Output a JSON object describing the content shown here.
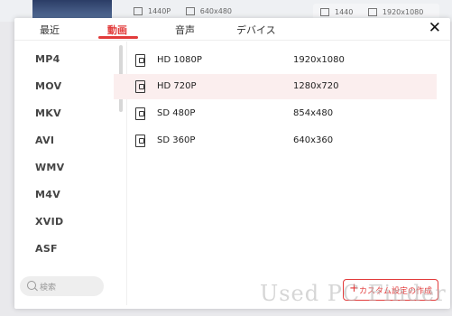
{
  "background": {
    "meta_left": [
      "1440P",
      "640x480"
    ],
    "meta_right": [
      "1440",
      "1920x1080"
    ]
  },
  "dialog": {
    "tabs": [
      {
        "label": "最近"
      },
      {
        "label": "動画"
      },
      {
        "label": "音声"
      },
      {
        "label": "デバイス"
      }
    ],
    "active_tab": "動画",
    "close_label": "✕",
    "formats": [
      "MP4",
      "MOV",
      "MKV",
      "AVI",
      "WMV",
      "M4V",
      "XVID",
      "ASF"
    ],
    "search_placeholder": "検索",
    "presets": [
      {
        "name": "HD 1080P",
        "resolution": "1920x1080"
      },
      {
        "name": "HD 720P",
        "resolution": "1280x720"
      },
      {
        "name": "SD 480P",
        "resolution": "854x480"
      },
      {
        "name": "SD 360P",
        "resolution": "640x360"
      }
    ],
    "custom_button_label": "カスタム設定の作成"
  },
  "watermark": "Used PC Finder",
  "colors": {
    "accent": "#e23b3b",
    "highlight_row": "#fbeeee"
  }
}
